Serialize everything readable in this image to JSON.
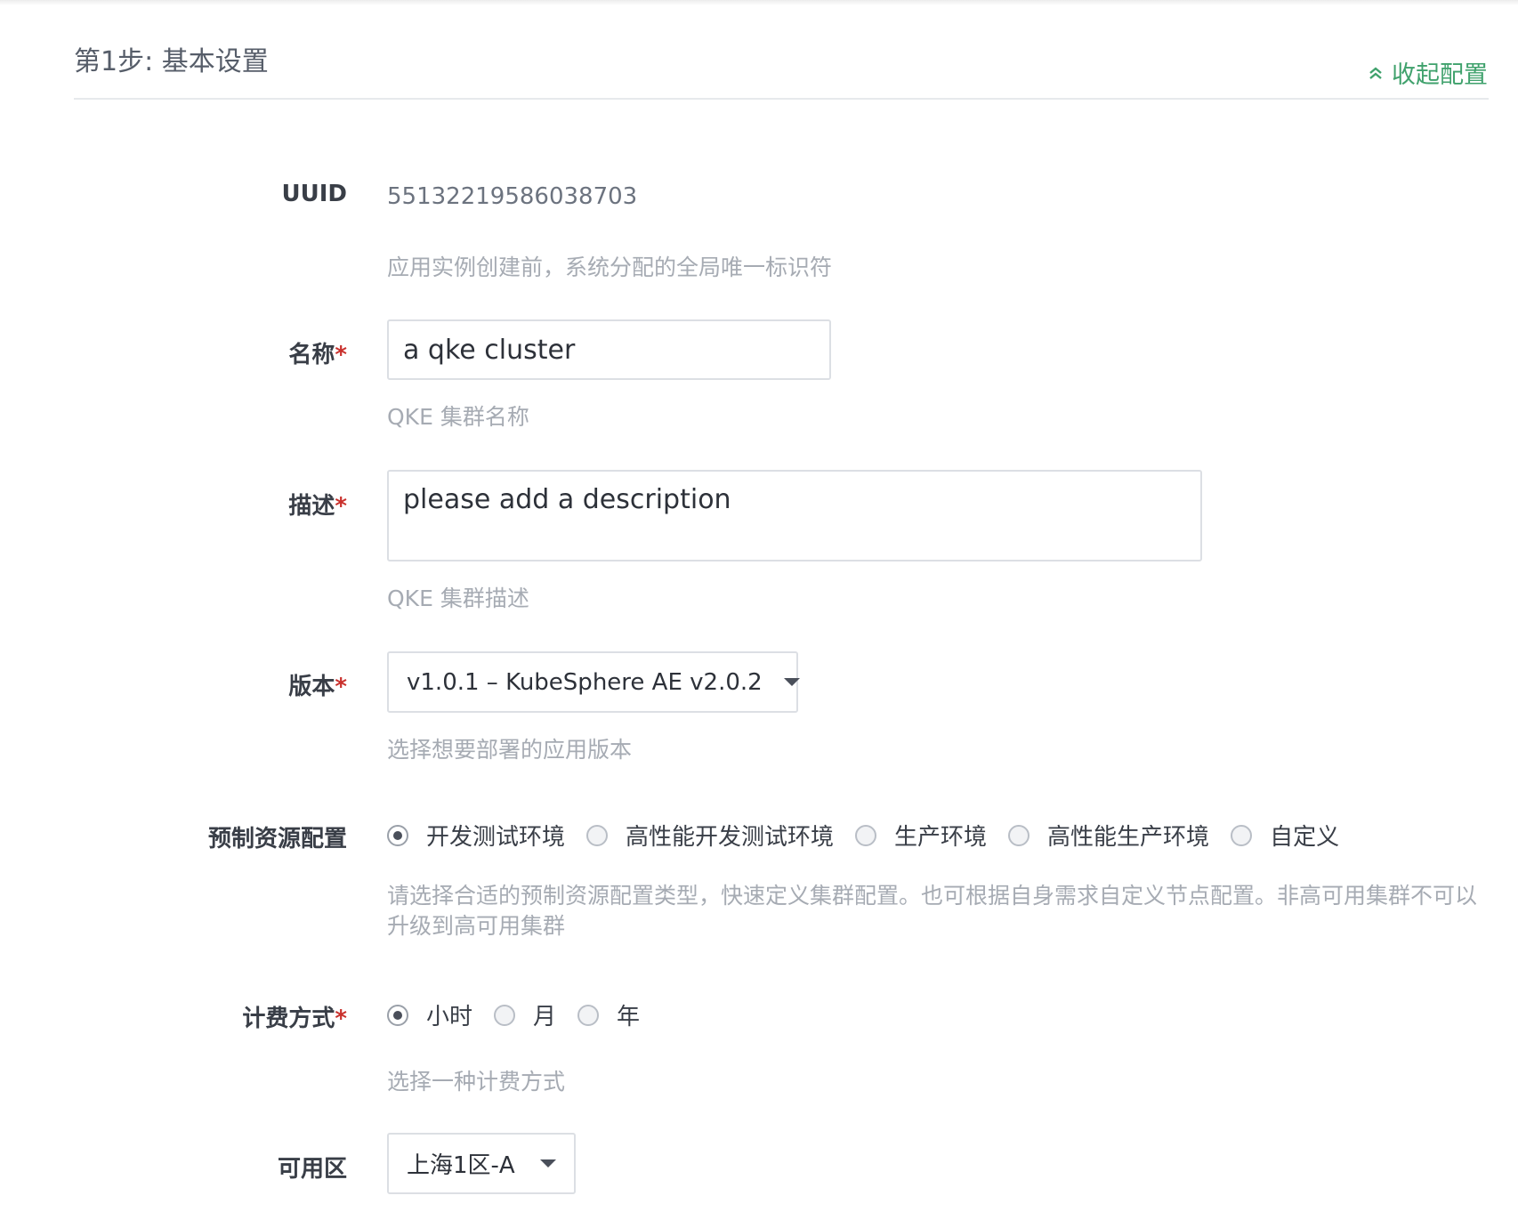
{
  "step_title": "第1步: 基本设置",
  "collapse_label": "收起配置",
  "collapse_icon": "double-chevron-up-icon",
  "colors": {
    "accent_green": "#3fa16c",
    "required_red": "#c9302c"
  },
  "fields": {
    "uuid": {
      "label": "UUID",
      "value": "55132219586038703",
      "help": "应用实例创建前，系统分配的全局唯一标识符"
    },
    "name": {
      "label": "名称",
      "required_mark": "*",
      "value": "a qke cluster",
      "help": "QKE 集群名称"
    },
    "description": {
      "label": "描述",
      "required_mark": "*",
      "value": "please add a description",
      "help": "QKE 集群描述"
    },
    "version": {
      "label": "版本",
      "required_mark": "*",
      "selected": "v1.0.1 – KubeSphere AE v2.0.2",
      "help": "选择想要部署的应用版本"
    },
    "preset": {
      "label": "预制资源配置",
      "options": [
        "开发测试环境",
        "高性能开发测试环境",
        "生产环境",
        "高性能生产环境",
        "自定义"
      ],
      "selected": "开发测试环境",
      "help": "请选择合适的预制资源配置类型，快速定义集群配置。也可根据自身需求自定义节点配置。非高可用集群不可以升级到高可用集群"
    },
    "billing": {
      "label": "计费方式",
      "required_mark": "*",
      "options": [
        "小时",
        "月",
        "年"
      ],
      "selected": "小时",
      "help": "选择一种计费方式"
    },
    "zone": {
      "label": "可用区",
      "selected": "上海1区-A"
    }
  }
}
